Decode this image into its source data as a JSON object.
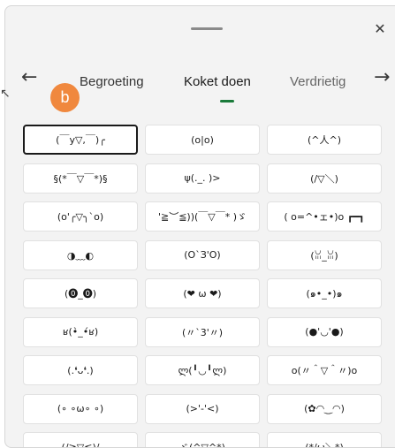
{
  "header": {
    "close_label": "✕",
    "prev_label": "←",
    "next_label": "→"
  },
  "tabs": [
    {
      "label": "Begroeting"
    },
    {
      "label": "Koket doen"
    },
    {
      "label": "Verdrietig"
    }
  ],
  "badge": {
    "label": "b"
  },
  "kaomoji": [
    "(￣y▽,￣)╭",
    "(o|o)",
    "(^人^)",
    "§(*￣▽￣*)§",
    "ψ(._. )>",
    "(/▽＼)",
    "(o'╭▽╮`o)",
    "'≧︶≦))(￣▽￣* )ゞ",
    "( o=^•ェ•)o ┏━┓",
    "◑﹏◐",
    "(O`З'O)",
    "(ꈍ_ꈍ)",
    "(⓿_⓿)",
    "(❤ ω ❤)",
    "(๑•_•)๑",
    "ʁ(•̀_•́ʁ)",
    "(〃`3'〃)",
    "(●'◡'●)",
    "(.❛ᴗ❛.)",
    "ლ(╹◡╹ლ)",
    "o(〃＾▽＾〃)o",
    "(∘ ∘ω∘ ∘)",
    "(>'-'<)",
    "(✿◠‿◠)",
    "(/≧▽≦)/",
    "ヾ(^▽^*)",
    "(*/ω＼*)"
  ],
  "colors": {
    "accent": "#1a7a3a",
    "badge": "#f0883e"
  }
}
